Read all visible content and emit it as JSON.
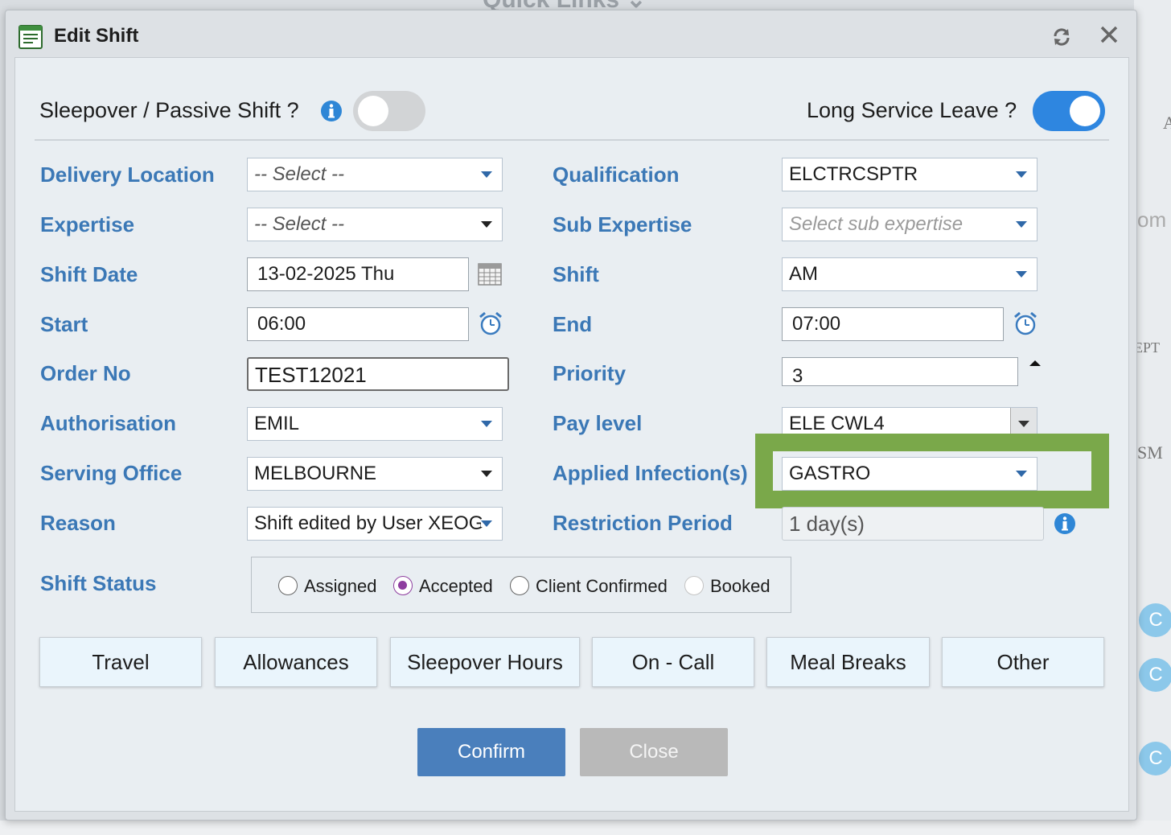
{
  "background": {
    "header_text": "Quick Links",
    "right_texts": [
      "A",
      "om",
      "EPT",
      "SM"
    ],
    "bubble_letter": "C"
  },
  "dialog": {
    "title": "Edit Shift",
    "title_icon": "document-list-icon",
    "refresh_icon": "refresh-icon",
    "close_icon": "close-icon"
  },
  "toggles": {
    "sleepover_label": "Sleepover / Passive Shift ?",
    "sleepover_on": false,
    "long_service_label": "Long Service Leave ?",
    "long_service_on": true
  },
  "form": {
    "delivery_location": {
      "label": "Delivery Location",
      "value": "-- Select --"
    },
    "expertise": {
      "label": "Expertise",
      "value": "-- Select --"
    },
    "shift_date": {
      "label": "Shift Date",
      "value": "13-02-2025 Thu"
    },
    "start": {
      "label": "Start",
      "value": "06:00"
    },
    "order_no": {
      "label": "Order No",
      "value": "TEST12021"
    },
    "authorisation": {
      "label": "Authorisation",
      "value": "EMIL"
    },
    "serving_office": {
      "label": "Serving Office",
      "value": "MELBOURNE"
    },
    "reason": {
      "label": "Reason",
      "value": "Shift edited by User XEOG"
    },
    "qualification": {
      "label": "Qualification",
      "value": "ELCTRCSPTR"
    },
    "sub_expertise": {
      "label": "Sub Expertise",
      "placeholder": "Select sub expertise"
    },
    "shift": {
      "label": "Shift",
      "value": "AM"
    },
    "end": {
      "label": "End",
      "value": "07:00"
    },
    "priority": {
      "label": "Priority",
      "value": "3"
    },
    "pay_level": {
      "label": "Pay level",
      "value": "ELE CWL4"
    },
    "applied_infections": {
      "label": "Applied Infection(s)",
      "value": "GASTRO"
    },
    "restriction_period": {
      "label": "Restriction Period",
      "value": "1 day(s)"
    }
  },
  "shift_status": {
    "label": "Shift Status",
    "options": [
      {
        "label": "Assigned",
        "selected": false,
        "disabled": false
      },
      {
        "label": "Accepted",
        "selected": true,
        "disabled": false
      },
      {
        "label": "Client Confirmed",
        "selected": false,
        "disabled": false
      },
      {
        "label": "Booked",
        "selected": false,
        "disabled": true
      }
    ]
  },
  "tabs": [
    "Travel",
    "Allowances",
    "Sleepover Hours",
    "On - Call",
    "Meal Breaks",
    "Other"
  ],
  "actions": {
    "confirm": "Confirm",
    "close": "Close"
  },
  "colors": {
    "label_blue": "#3b78b6",
    "toggle_on": "#2e86e0",
    "toggle_off": "#d2d4d6",
    "highlight": "#7aa84a",
    "confirm_bg": "#4a7fbc",
    "close_bg": "#b9b9b9"
  }
}
